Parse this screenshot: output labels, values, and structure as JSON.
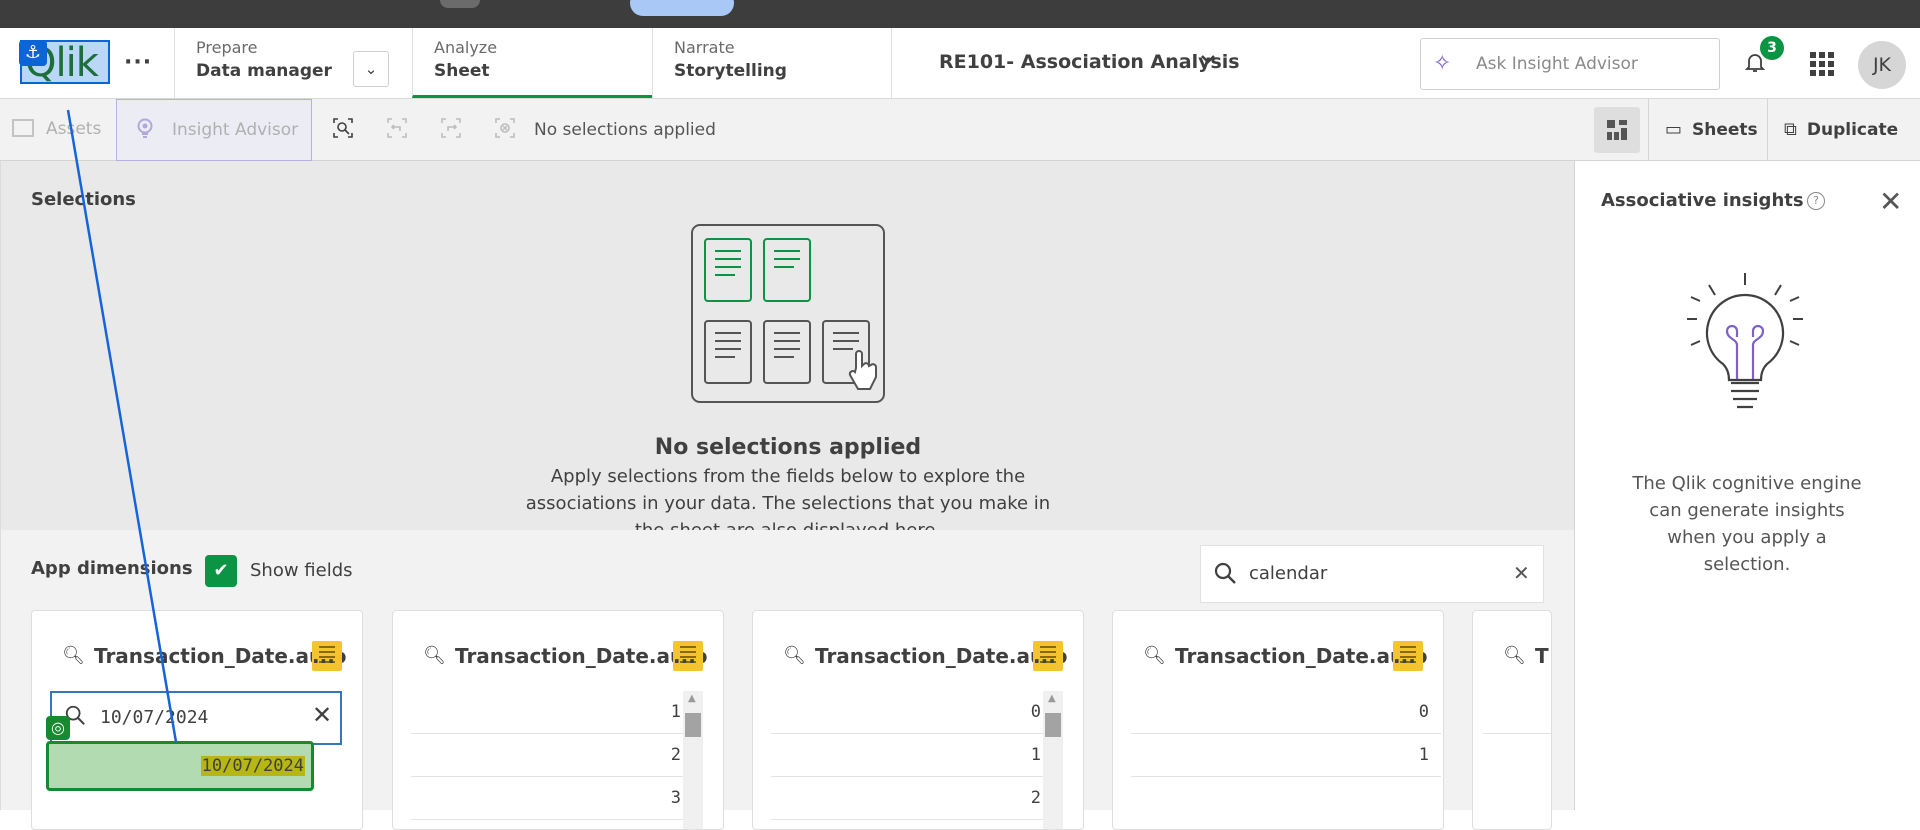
{
  "header": {
    "logo": "Qlik",
    "nav": [
      {
        "label": "Prepare",
        "value": "Data manager"
      },
      {
        "label": "Analyze",
        "value": "Sheet"
      },
      {
        "label": "Narrate",
        "value": "Storytelling"
      }
    ],
    "app_title": "RE101- Association Analysis",
    "ask_placeholder": "Ask Insight Advisor",
    "notification_count": "3",
    "user_initials": "JK"
  },
  "toolbar": {
    "assets_label": "Assets",
    "insight_label": "Insight Advisor",
    "selection_status": "No selections applied",
    "sheets_label": "Sheets",
    "duplicate_label": "Duplicate"
  },
  "selections": {
    "title": "Selections",
    "empty_title": "No selections applied",
    "empty_desc": "Apply selections from the fields below to explore the associations in your data. The selections that you make in the sheet are also displayed here."
  },
  "insights": {
    "title": "Associative insights",
    "text": "The Qlik cognitive engine can generate insights when you apply a selection."
  },
  "dimensions": {
    "title": "App dimensions",
    "show_fields_label": "Show fields",
    "search_value": "calendar",
    "cards": [
      {
        "title": "Transaction_Date.auto",
        "search_value": "10/07/2024",
        "result": "10/07/2024"
      },
      {
        "title": "Transaction_Date.auto",
        "rows": [
          "1",
          "2",
          "3"
        ]
      },
      {
        "title": "Transaction_Date.auto",
        "rows": [
          "0",
          "1",
          "2"
        ]
      },
      {
        "title": "Transaction_Date.auto",
        "rows": [
          "0",
          "1"
        ]
      },
      {
        "title": "T"
      }
    ]
  },
  "colors": {
    "accent_green": "#0b9444",
    "highlight_blue": "#0b65d8",
    "insight_purple": "#7b61c9"
  }
}
